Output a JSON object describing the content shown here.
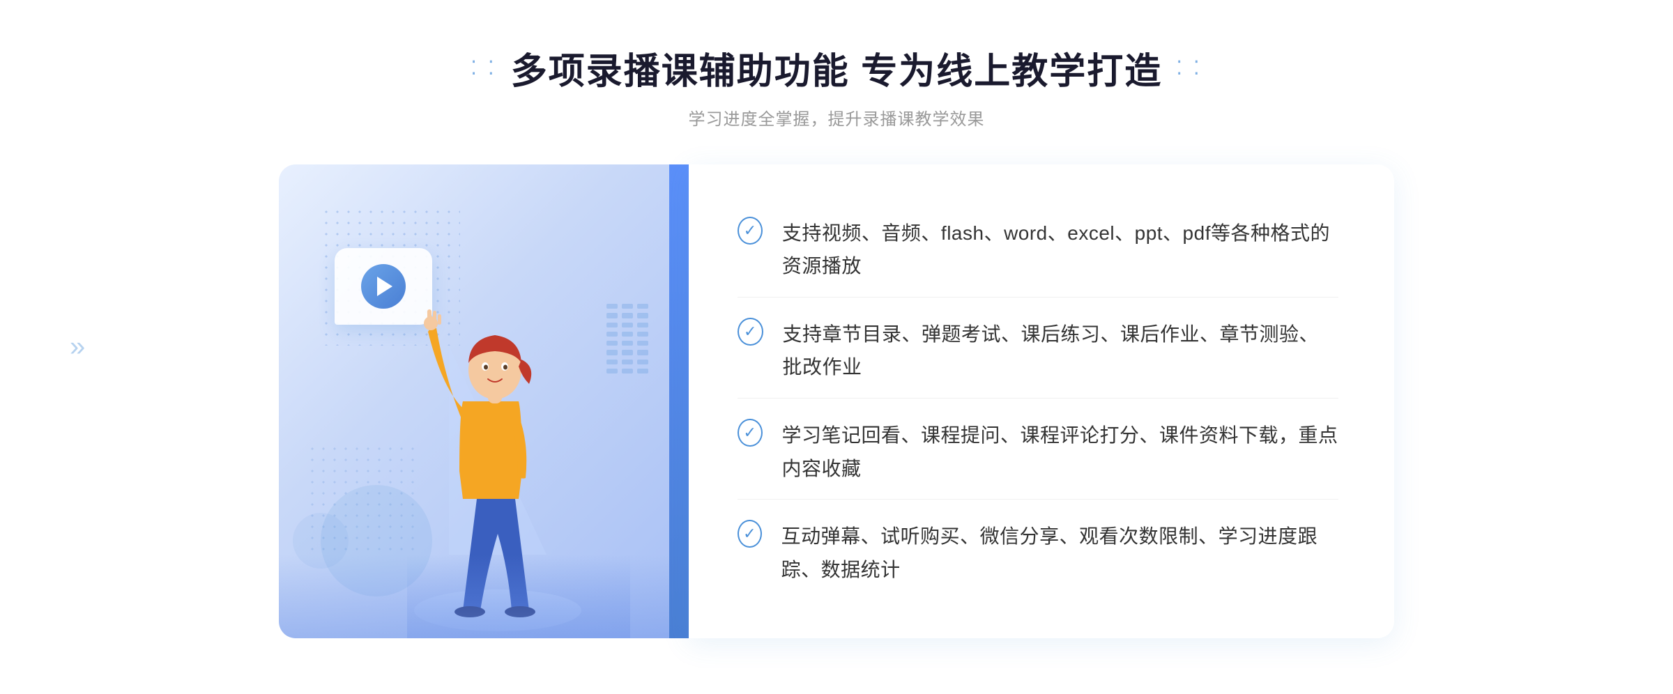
{
  "header": {
    "title": "多项录播课辅助功能 专为线上教学打造",
    "subtitle": "学习进度全掌握，提升录播课教学效果",
    "dots_left": "⁚⁚",
    "dots_right": "⁚⁚"
  },
  "features": [
    {
      "id": 1,
      "text": "支持视频、音频、flash、word、excel、ppt、pdf等各种格式的资源播放"
    },
    {
      "id": 2,
      "text": "支持章节目录、弹题考试、课后练习、课后作业、章节测验、批改作业"
    },
    {
      "id": 3,
      "text": "学习笔记回看、课程提问、课程评论打分、课件资料下载，重点内容收藏"
    },
    {
      "id": 4,
      "text": "互动弹幕、试听购买、微信分享、观看次数限制、学习进度跟踪、数据统计"
    }
  ],
  "arrows_decoration": "»",
  "play_button_aria": "play-button"
}
